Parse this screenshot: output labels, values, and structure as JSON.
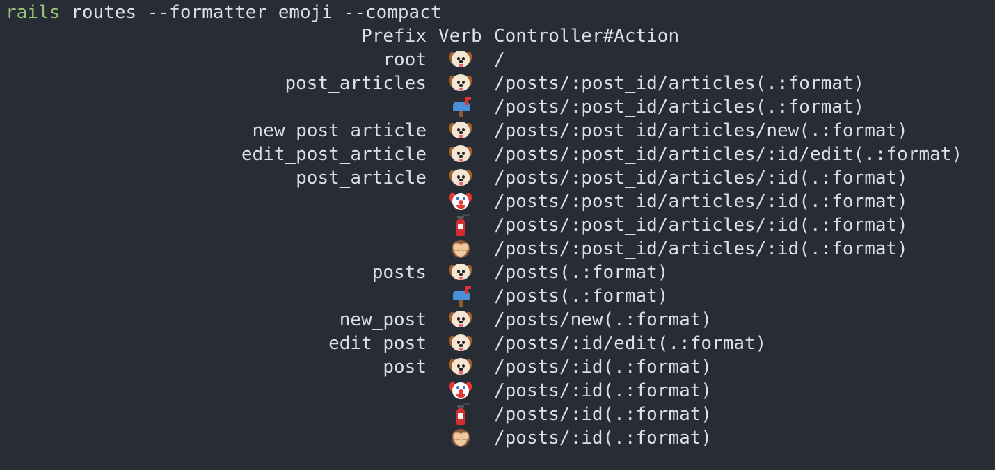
{
  "command": {
    "program": "rails",
    "arguments": "routes --formatter emoji --compact"
  },
  "header": {
    "prefix": "Prefix",
    "verb": "Verb",
    "action": "Controller#Action"
  },
  "routes": [
    {
      "prefix": "root",
      "verb_icon": "dog-icon",
      "path": "/"
    },
    {
      "prefix": "post_articles",
      "verb_icon": "dog-icon",
      "path": "/posts/:post_id/articles(.:format)"
    },
    {
      "prefix": "",
      "verb_icon": "mailbox-icon",
      "path": "/posts/:post_id/articles(.:format)"
    },
    {
      "prefix": "new_post_article",
      "verb_icon": "dog-icon",
      "path": "/posts/:post_id/articles/new(.:format)"
    },
    {
      "prefix": "edit_post_article",
      "verb_icon": "dog-icon",
      "path": "/posts/:post_id/articles/:id/edit(.:format)"
    },
    {
      "prefix": "post_article",
      "verb_icon": "dog-icon",
      "path": "/posts/:post_id/articles/:id(.:format)"
    },
    {
      "prefix": "",
      "verb_icon": "clown-icon",
      "path": "/posts/:post_id/articles/:id(.:format)"
    },
    {
      "prefix": "",
      "verb_icon": "extinguisher-icon",
      "path": "/posts/:post_id/articles/:id(.:format)"
    },
    {
      "prefix": "",
      "verb_icon": "monkey-icon",
      "path": "/posts/:post_id/articles/:id(.:format)"
    },
    {
      "prefix": "posts",
      "verb_icon": "dog-icon",
      "path": "/posts(.:format)"
    },
    {
      "prefix": "",
      "verb_icon": "mailbox-icon",
      "path": "/posts(.:format)"
    },
    {
      "prefix": "new_post",
      "verb_icon": "dog-icon",
      "path": "/posts/new(.:format)"
    },
    {
      "prefix": "edit_post",
      "verb_icon": "dog-icon",
      "path": "/posts/:id/edit(.:format)"
    },
    {
      "prefix": "post",
      "verb_icon": "dog-icon",
      "path": "/posts/:id(.:format)"
    },
    {
      "prefix": "",
      "verb_icon": "clown-icon",
      "path": "/posts/:id(.:format)"
    },
    {
      "prefix": "",
      "verb_icon": "extinguisher-icon",
      "path": "/posts/:id(.:format)"
    },
    {
      "prefix": "",
      "verb_icon": "monkey-icon",
      "path": "/posts/:id(.:format)"
    }
  ],
  "colors": {
    "background": "#282c34",
    "text": "#dcdfe4",
    "command": "#98c379"
  }
}
